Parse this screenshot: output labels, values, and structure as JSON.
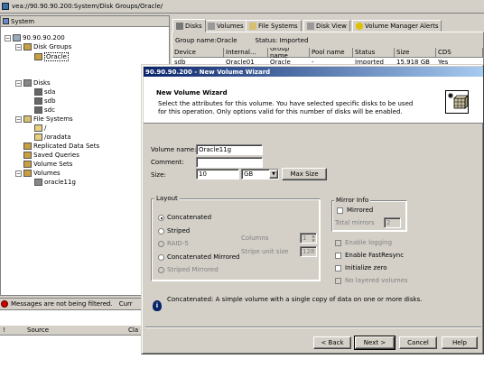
{
  "window": {
    "address": "vea://90.90.90.200:System/Disk Groups/Oracle/"
  },
  "tree": {
    "header": "System",
    "items": [
      {
        "label": "90.90.90.200"
      },
      {
        "label": "Disk Groups"
      },
      {
        "label": "Oracle"
      },
      {
        "label": "Disks"
      },
      {
        "label": "sda"
      },
      {
        "label": "sdb"
      },
      {
        "label": "sdc"
      },
      {
        "label": "File Systems"
      },
      {
        "label": "/"
      },
      {
        "label": "/oradata"
      },
      {
        "label": "Replicated Data Sets"
      },
      {
        "label": "Saved Queries"
      },
      {
        "label": "Volume Sets"
      },
      {
        "label": "Volumes"
      },
      {
        "label": "oracle11g"
      }
    ]
  },
  "tabs": [
    {
      "label": "Disks"
    },
    {
      "label": "Volumes"
    },
    {
      "label": "File Systems"
    },
    {
      "label": "Disk View"
    },
    {
      "label": "Volume Manager Alerts"
    }
  ],
  "info_bar": {
    "group_name": "Group name:Oracle",
    "status": "Status: Imported"
  },
  "table": {
    "columns": [
      "Device",
      "Internal...",
      "Group name",
      "Pool name",
      "Status",
      "Size",
      "CDS"
    ],
    "rows": [
      [
        "sdb",
        "Oracle01",
        "Oracle",
        "-",
        "Imported",
        "15.918 GB",
        "Yes"
      ]
    ]
  },
  "bottom": {
    "filter_message": "Messages are not being filtered.",
    "filter_more": "Curr",
    "source_header": "Source",
    "class_header": "Cla"
  },
  "dialog": {
    "title": "90.90.90.200 - New Volume Wizard",
    "header_title": "New Volume Wizard",
    "header_desc_line1": "Select the attributes for this volume.  You have selected specific disks to be used",
    "header_desc_line2": "for this operation.  Only options valid for this number of disks will be enabled.",
    "volume_name_label": "Volume name:",
    "volume_name_value": "Oracle11g",
    "comment_label": "Comment:",
    "comment_value": "",
    "size_label": "Size:",
    "size_value": "10",
    "size_unit": "GB",
    "max_size_label": "Max Size",
    "layout_title": "Layout",
    "layouts": [
      {
        "label": "Concatenated",
        "selected": true,
        "enabled": true
      },
      {
        "label": "Striped",
        "selected": false,
        "enabled": true
      },
      {
        "label": "RAID-5",
        "selected": false,
        "enabled": false
      },
      {
        "label": "Concatenated Mirrored",
        "selected": false,
        "enabled": true
      },
      {
        "label": "Striped Mirrored",
        "selected": false,
        "enabled": false
      }
    ],
    "columns_label": "Columns",
    "columns_value": "1",
    "stripe_label": "Stripe unit size",
    "stripe_value": "128",
    "mirror_title": "Mirror Info",
    "mirrored_label": "Mirrored",
    "total_mirrors_label": "Total mirrors",
    "total_mirrors_value": "2",
    "options": [
      {
        "label": "Enable logging",
        "enabled": false
      },
      {
        "label": "Enable FastResync",
        "enabled": true
      },
      {
        "label": "Initialize zero",
        "enabled": true
      },
      {
        "label": "No layered volumes",
        "enabled": false
      }
    ],
    "info_text": "Concatenated: A simple volume with a single copy of data on one or more disks.",
    "buttons": {
      "back": "< Back",
      "next": "Next >",
      "cancel": "Cancel",
      "help": "Help"
    }
  },
  "colors": {
    "title_bar": "#0a246a",
    "title_bar_end": "#a6caf0",
    "desktop": "#d4d0c8"
  }
}
